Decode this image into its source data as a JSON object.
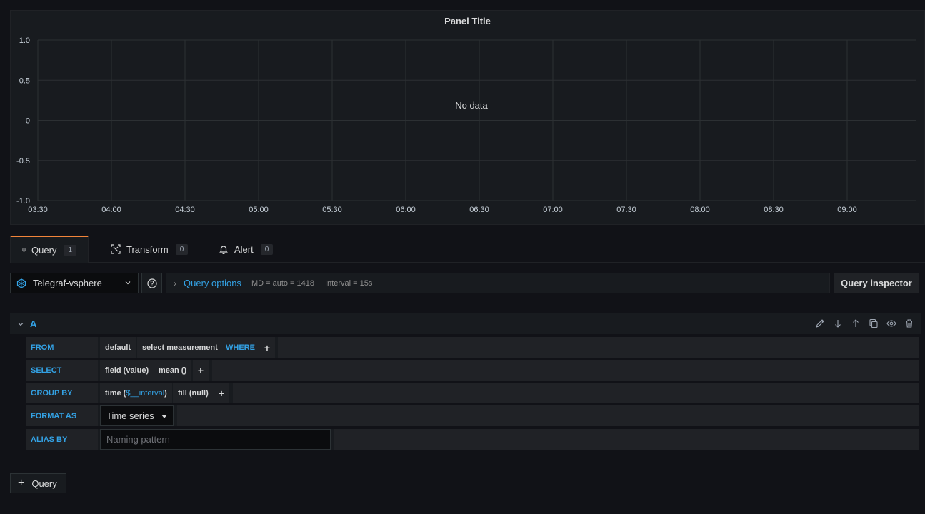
{
  "panel": {
    "title": "Panel Title",
    "no_data": "No data",
    "y_ticks": [
      "1.0",
      "0.5",
      "0",
      "-0.5",
      "-1.0"
    ],
    "x_ticks": [
      "03:30",
      "04:00",
      "04:30",
      "05:00",
      "05:30",
      "06:00",
      "06:30",
      "07:00",
      "07:30",
      "08:00",
      "08:30",
      "09:00"
    ]
  },
  "tabs": [
    {
      "label": "Query",
      "count": "1",
      "icon": "database-icon"
    },
    {
      "label": "Transform",
      "count": "0",
      "icon": "transform-icon"
    },
    {
      "label": "Alert",
      "count": "0",
      "icon": "bell-icon"
    }
  ],
  "toolbar": {
    "datasource": "Telegraf-vsphere",
    "query_options_label": "Query options",
    "md": "MD = auto = 1418",
    "interval": "Interval = 15s",
    "query_inspector": "Query inspector"
  },
  "query": {
    "ref_id": "A",
    "from_label": "FROM",
    "policy": "default",
    "measurement": "select measurement",
    "where_label": "WHERE",
    "select_label": "SELECT",
    "field": "field (value)",
    "func": "mean ()",
    "group_by_label": "GROUP BY",
    "time_prefix": "time (",
    "time_var": "$__interval",
    "time_suffix": ")",
    "fill": "fill (null)",
    "format_as_label": "FORMAT AS",
    "format_value": "Time series",
    "alias_by_label": "ALIAS BY",
    "alias_placeholder": "Naming pattern",
    "plus": "+"
  },
  "add_query": {
    "plus": "+",
    "label": "Query"
  }
}
